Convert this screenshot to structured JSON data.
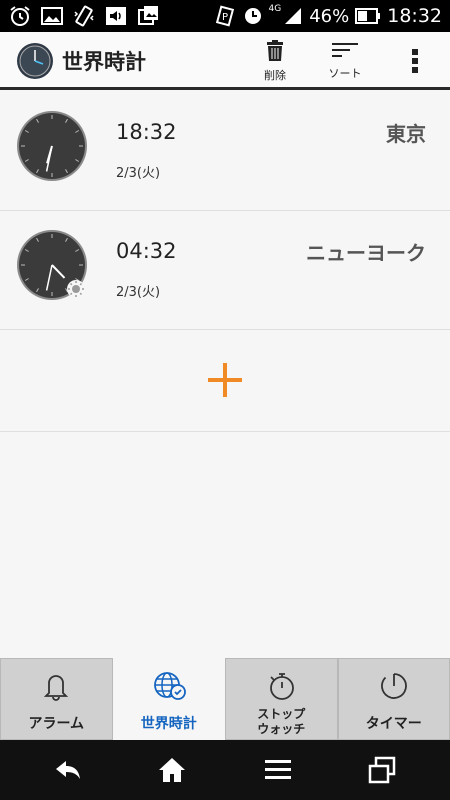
{
  "status_bar": {
    "network": "4G",
    "battery": "46%",
    "time": "18:32"
  },
  "app_bar": {
    "title": "世界時計",
    "actions": {
      "delete_label": "削除",
      "sort_label": "ソート"
    }
  },
  "clocks": [
    {
      "time": "18:32",
      "date": "2/3(火)",
      "city": "東京",
      "hour_angle": 196,
      "minute_angle": 192,
      "daytime_indicator": false
    },
    {
      "time": "04:32",
      "date": "2/3(火)",
      "city": "ニューヨーク",
      "hour_angle": 136,
      "minute_angle": 192,
      "daytime_indicator": true
    }
  ],
  "add_button": {
    "icon": "plus-icon",
    "color": "#f08a24"
  },
  "tabs": [
    {
      "label": "アラーム",
      "icon": "bell-icon",
      "active": false
    },
    {
      "label": "世界時計",
      "icon": "globe-icon",
      "active": true
    },
    {
      "label_line1": "ストップ",
      "label_line2": "ウォッチ",
      "icon": "stopwatch-icon",
      "active": false
    },
    {
      "label": "タイマー",
      "icon": "timer-icon",
      "active": false
    }
  ],
  "colors": {
    "accent_blue": "#1565c0",
    "add_orange": "#f08a24"
  }
}
